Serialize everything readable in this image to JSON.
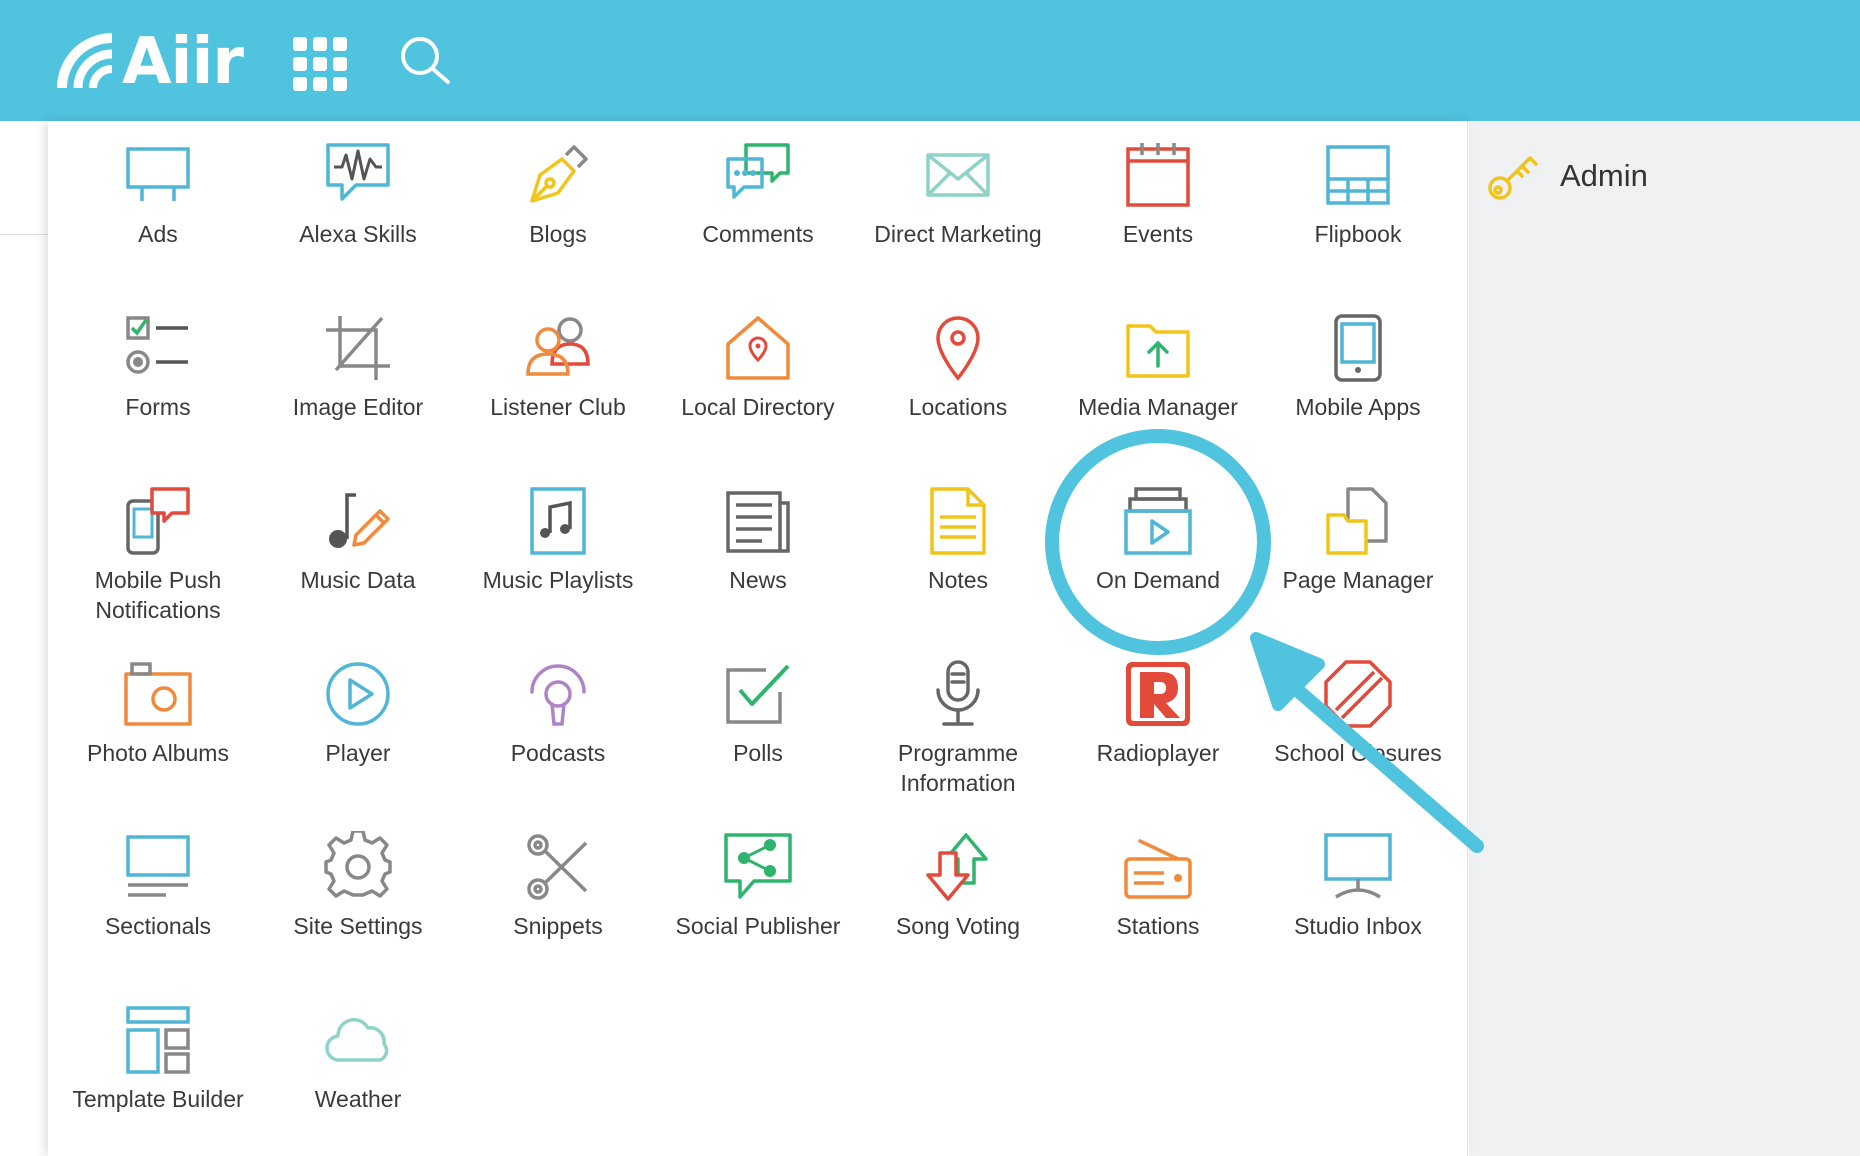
{
  "header": {
    "brand": "Aiir",
    "apps_icon": "grid-icon",
    "search_icon": "search-icon"
  },
  "apps": [
    {
      "label": "Ads",
      "icon": "billboard-icon"
    },
    {
      "label": "Alexa Skills",
      "icon": "voice-bubble-icon"
    },
    {
      "label": "Blogs",
      "icon": "pen-nib-icon"
    },
    {
      "label": "Comments",
      "icon": "chat-bubbles-icon"
    },
    {
      "label": "Direct Marketing",
      "icon": "envelope-icon"
    },
    {
      "label": "Events",
      "icon": "calendar-icon"
    },
    {
      "label": "Flipbook",
      "icon": "flipbook-icon"
    },
    {
      "label": "Forms",
      "icon": "form-checklist-icon"
    },
    {
      "label": "Image Editor",
      "icon": "crop-icon"
    },
    {
      "label": "Listener Club",
      "icon": "users-icon"
    },
    {
      "label": "Local Directory",
      "icon": "house-pin-icon"
    },
    {
      "label": "Locations",
      "icon": "map-pin-icon"
    },
    {
      "label": "Media Manager",
      "icon": "folder-upload-icon"
    },
    {
      "label": "Mobile Apps",
      "icon": "tablet-icon"
    },
    {
      "label": "Mobile Push Notifications",
      "icon": "phone-notification-icon"
    },
    {
      "label": "Music Data",
      "icon": "music-note-pencil-icon"
    },
    {
      "label": "Music Playlists",
      "icon": "music-file-icon"
    },
    {
      "label": "News",
      "icon": "newspaper-icon"
    },
    {
      "label": "Notes",
      "icon": "note-icon"
    },
    {
      "label": "On Demand",
      "icon": "video-stack-icon"
    },
    {
      "label": "Page Manager",
      "icon": "page-folder-icon"
    },
    {
      "label": "Photo Albums",
      "icon": "camera-icon"
    },
    {
      "label": "Player",
      "icon": "play-circle-icon"
    },
    {
      "label": "Podcasts",
      "icon": "podcast-icon"
    },
    {
      "label": "Polls",
      "icon": "checkbox-icon"
    },
    {
      "label": "Programme Information",
      "icon": "microphone-icon"
    },
    {
      "label": "Radioplayer",
      "icon": "radioplayer-logo-icon"
    },
    {
      "label": "School Closures",
      "icon": "closed-sign-icon"
    },
    {
      "label": "Sectionals",
      "icon": "monitor-lines-icon"
    },
    {
      "label": "Site Settings",
      "icon": "gear-icon"
    },
    {
      "label": "Snippets",
      "icon": "scissors-icon"
    },
    {
      "label": "Social Publisher",
      "icon": "share-bubble-icon"
    },
    {
      "label": "Song Voting",
      "icon": "vote-arrows-icon"
    },
    {
      "label": "Stations",
      "icon": "radio-icon"
    },
    {
      "label": "Studio Inbox",
      "icon": "desktop-icon"
    },
    {
      "label": "Template Builder",
      "icon": "layout-icon"
    },
    {
      "label": "Weather",
      "icon": "cloud-icon"
    }
  ],
  "admin": {
    "label": "Admin",
    "icon": "key-icon",
    "icon_color": "#f0c419"
  },
  "annotation": {
    "highlight_color": "#50c3df"
  }
}
